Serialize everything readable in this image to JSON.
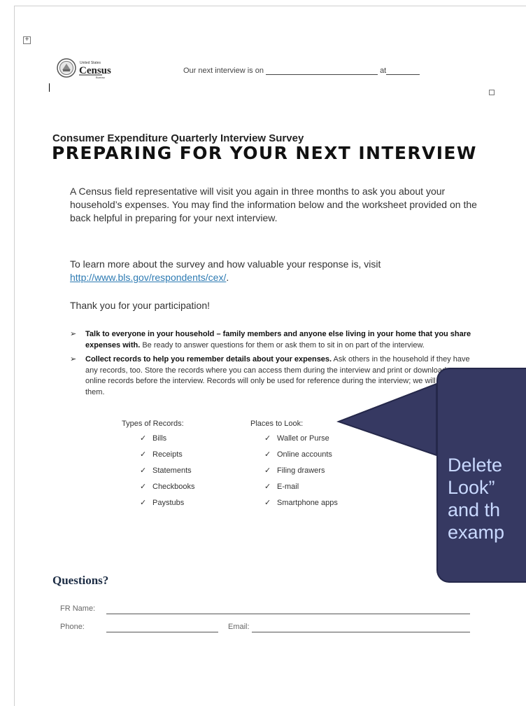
{
  "header": {
    "logo_small": "United States",
    "logo_big": "Census",
    "logo_sub": "Bureau",
    "next_interview_label": "Our next interview is on",
    "at_label": "at"
  },
  "survey_name": "Consumer Expenditure Quarterly Interview Survey",
  "main_title": "PREPARING FOR YOUR NEXT INTERVIEW",
  "intro_paragraph": "A Census field representative will visit you again in three months to ask you about your household’s expenses.  You may find the information below and the worksheet provided on the back helpful in preparing for your next interview.",
  "learn_more": {
    "text": "To learn more about the survey and how valuable your response is, visit",
    "link": "http://www.bls.gov/respondents/cex/",
    "trailing": "."
  },
  "thank_you": "Thank you for your participation!",
  "bullets": [
    {
      "bold": "Talk to everyone in your household – family members and anyone else living in your home that you share expenses with.",
      "text": " Be ready to answer questions for them or ask them to sit in on part of the interview."
    },
    {
      "bold": "Collect records to help you remember details about your expenses.",
      "text": " Ask others in the household if they have any records, too.  Store the records where you can access them during the interview and print or download any online records before the interview. Records will only be used for reference during the interview; we will not keep them."
    }
  ],
  "record_types": {
    "header": "Types of Records:",
    "items": [
      "Bills",
      "Receipts",
      "Statements",
      "Checkbooks",
      "Paystubs"
    ]
  },
  "places_to_look": {
    "header": "Places to Look:",
    "items": [
      "Wallet or Purse",
      "Online accounts",
      "Filing drawers",
      "E-mail",
      "Smartphone apps"
    ]
  },
  "check_symbol": "✓",
  "arrow_symbol": "➢",
  "move_handle_symbol": "+",
  "questions": {
    "heading": "Questions?",
    "fr_name_label": "FR Name:",
    "phone_label": "Phone:",
    "email_label": "Email:"
  },
  "callout": {
    "text_line1": "Delete",
    "text_line2": "Look”",
    "text_line3": "and th",
    "text_line4": "examp",
    "bg_color": "#363962",
    "text_color": "#c9d9ff"
  },
  "colors": {
    "link": "#2e7bb3",
    "questions_heading": "#1c2c44"
  }
}
